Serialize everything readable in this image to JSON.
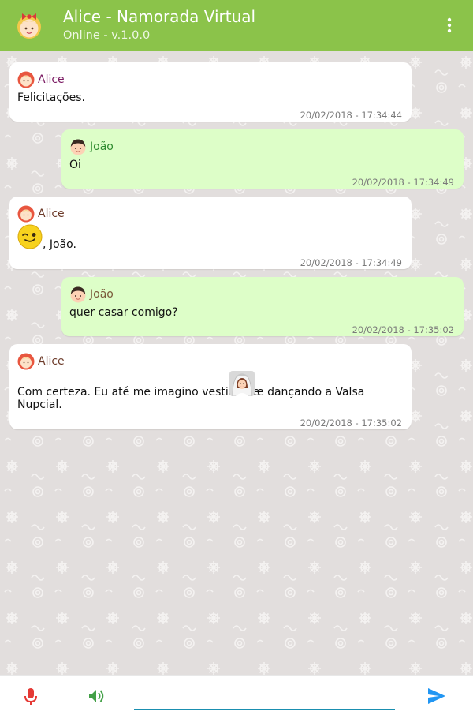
{
  "header": {
    "title": "Alice - Namorada Virtual",
    "subtitle": "Online - v.1.0.0"
  },
  "messages": [
    {
      "sender": "Alice",
      "text": "Felicitações.",
      "time": "20/02/2018 - 17:34:44"
    },
    {
      "sender": "João",
      "text": "Oi",
      "time": "20/02/2018 - 17:34:49"
    },
    {
      "sender": "Alice",
      "text": ", João.",
      "time": "20/02/2018 - 17:34:49"
    },
    {
      "sender": "João",
      "text": "quer casar comigo?",
      "time": "20/02/2018 - 17:35:02"
    },
    {
      "sender": "Alice",
      "text_before": "Com certeza. Eu até me imagino vestida de",
      "text_after": "e dançando a Valsa",
      "text_line2": "Nupcial.",
      "time": "20/02/2018 - 17:35:02"
    }
  ],
  "colors": {
    "appbar": "#8bc34a",
    "alice_bubble": "#ffffff",
    "joao_bubble": "#ddfec8",
    "alice_name_first": "#7b1b63",
    "alice_name": "#6d3b2a",
    "joao_name_first": "#2e8b2e",
    "joao_name": "#7a5a3a",
    "input_underline": "#1a8fb0",
    "send_icon": "#2196f3"
  },
  "icons": {
    "menu": "more-vert-icon",
    "mic": "microphone-icon",
    "speaker": "speaker-icon",
    "send": "send-icon"
  },
  "input": {
    "value": "",
    "placeholder": ""
  }
}
